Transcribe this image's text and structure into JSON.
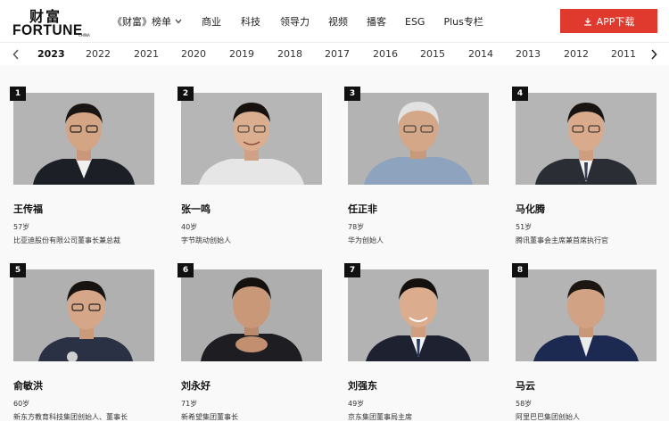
{
  "logo": {
    "cn": "财富",
    "en": "FORTUNE",
    "tm": "CHINA"
  },
  "nav": [
    {
      "label": "《财富》榜单",
      "has_dropdown": true
    },
    {
      "label": "商业"
    },
    {
      "label": "科技"
    },
    {
      "label": "领导力"
    },
    {
      "label": "视频"
    },
    {
      "label": "播客"
    },
    {
      "label": "ESG"
    },
    {
      "label": "Plus专栏"
    }
  ],
  "app_button": {
    "label": "APP下载",
    "color": "#e03a2f"
  },
  "years": [
    "2023",
    "2022",
    "2021",
    "2020",
    "2019",
    "2018",
    "2017",
    "2016",
    "2015",
    "2014",
    "2013",
    "2012",
    "2011"
  ],
  "active_year": "2023",
  "people": [
    {
      "rank": "1",
      "name": "王传福",
      "age": "57岁",
      "title": "比亚迪股份有限公司董事长兼总裁"
    },
    {
      "rank": "2",
      "name": "张一鸣",
      "age": "40岁",
      "title": "字节跳动创始人"
    },
    {
      "rank": "3",
      "name": "任正非",
      "age": "78岁",
      "title": "华为创始人"
    },
    {
      "rank": "4",
      "name": "马化腾",
      "age": "51岁",
      "title": "腾讯董事会主席兼首席执行官"
    },
    {
      "rank": "5",
      "name": "俞敏洪",
      "age": "60岁",
      "title": "新东方教育科技集团创始人、董事长"
    },
    {
      "rank": "6",
      "name": "刘永好",
      "age": "71岁",
      "title": "新希望集团董事长"
    },
    {
      "rank": "7",
      "name": "刘强东",
      "age": "49岁",
      "title": "京东集团董事局主席"
    },
    {
      "rank": "8",
      "name": "马云",
      "age": "58岁",
      "title": "阿里巴巴集团创始人"
    }
  ],
  "icons": {
    "download": "download-icon",
    "prev": "chevron-left-icon",
    "next": "chevron-right-icon",
    "dropdown": "chevron-down-icon"
  }
}
